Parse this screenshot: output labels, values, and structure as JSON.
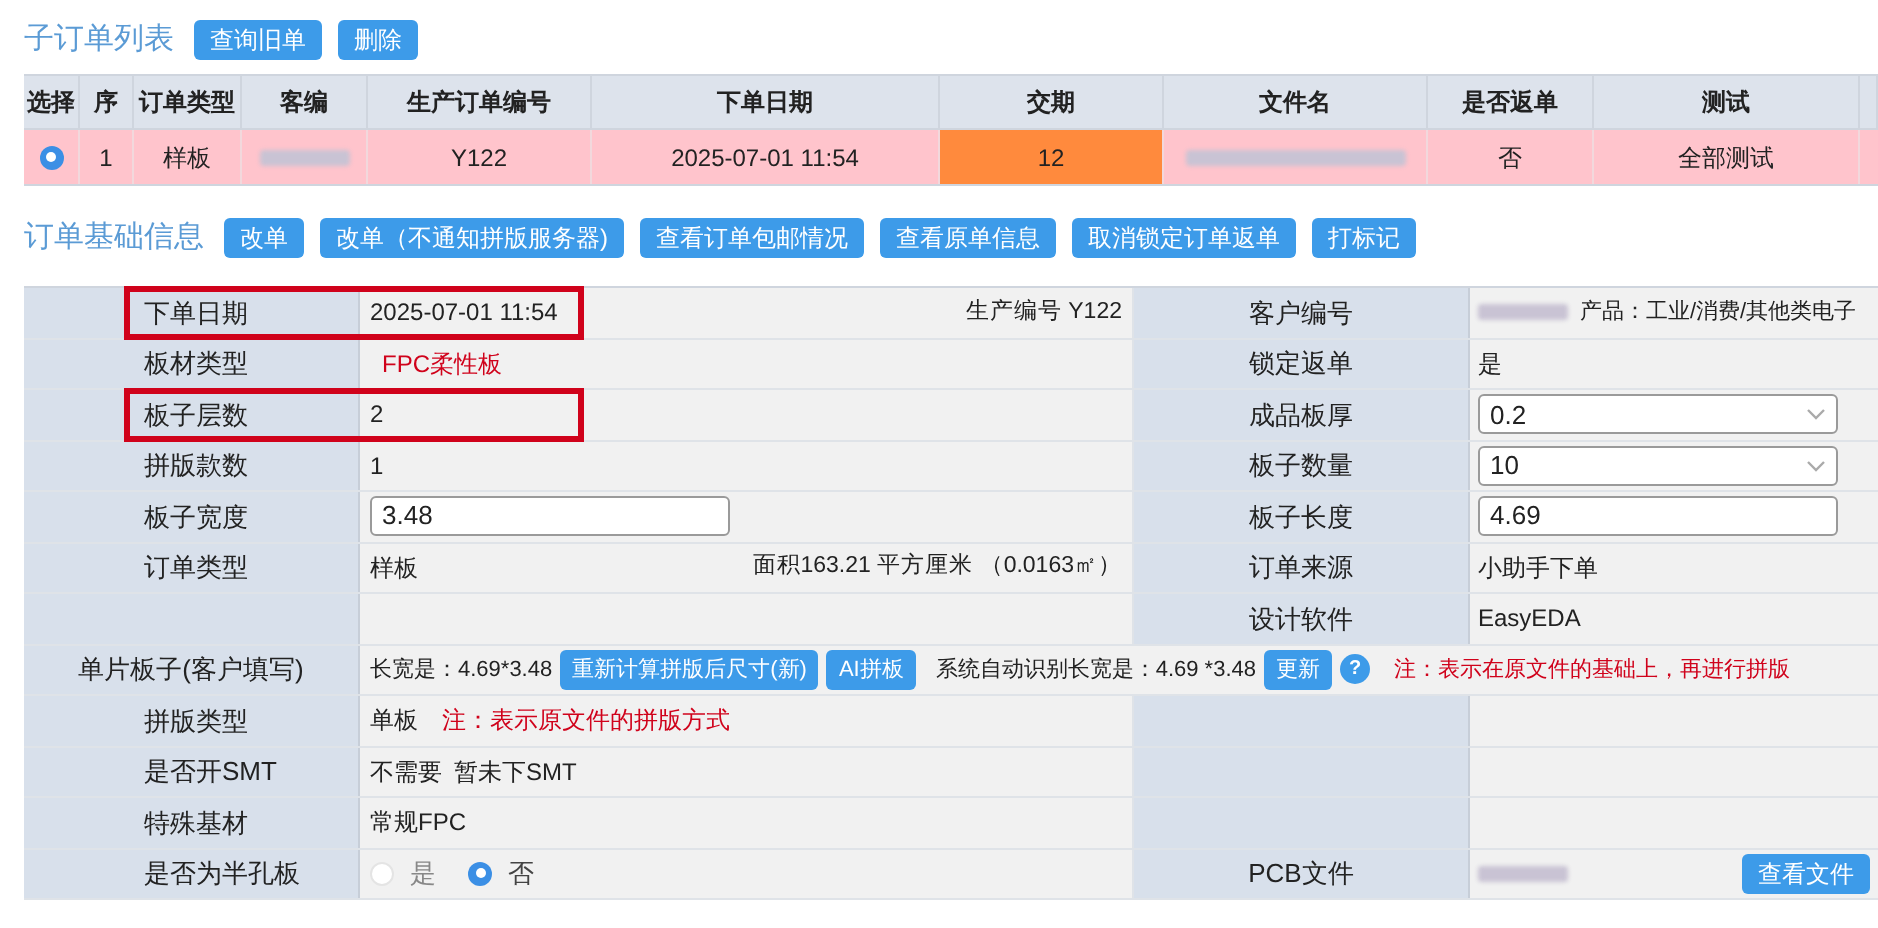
{
  "sub_orders": {
    "title": "子订单列表",
    "buttons": [
      "查询旧单",
      "删除"
    ],
    "columns": [
      "选择",
      "序",
      "订单类型",
      "客编",
      "生产订单编号",
      "下单日期",
      "交期",
      "文件名",
      "是否返单",
      "测试"
    ],
    "rows": [
      {
        "selected": true,
        "cells": [
          {
            "kind": "radio"
          },
          {
            "kind": "text",
            "text": "1"
          },
          {
            "kind": "text",
            "text": "样板"
          },
          {
            "kind": "blurred"
          },
          {
            "kind": "text",
            "text": "Y122"
          },
          {
            "kind": "text",
            "text": "2025-07-01 11:54"
          },
          {
            "kind": "text",
            "text": "12",
            "highlighted": true
          },
          {
            "kind": "blurred"
          },
          {
            "kind": "text",
            "text": "否"
          },
          {
            "kind": "text",
            "text": "全部测试"
          }
        ]
      }
    ]
  },
  "order_info": {
    "title": "订单基础信息",
    "buttons": [
      "改单",
      "改单（不通知拼版服务器)",
      "查看订单包邮情况",
      "查看原单信息",
      "取消锁定订单返单",
      "打标记"
    ],
    "rows": [
      {
        "kind": "pair",
        "highlighted": true,
        "label": "下单日期",
        "value": [
          {
            "kind": "text",
            "text": "2025-07-01 11:54"
          },
          {
            "kind": "aside",
            "text": "生产编号 Y122"
          }
        ],
        "label2": "客户编号",
        "value2": [
          {
            "kind": "blurred"
          },
          {
            "kind": "small",
            "text": "产品：工业/消费/其他类电子"
          }
        ]
      },
      {
        "kind": "pair",
        "highlighted": false,
        "label": "板材类型",
        "value": [
          {
            "kind": "red",
            "text": "FPC柔性板"
          }
        ],
        "label2": "锁定返单",
        "value2": [
          {
            "kind": "text",
            "text": "是"
          }
        ]
      },
      {
        "kind": "pair",
        "highlighted": true,
        "label": "板子层数",
        "value": [
          {
            "kind": "text",
            "text": "2"
          }
        ],
        "label2": "成品板厚",
        "value2": [
          {
            "kind": "select",
            "text": "0.2"
          }
        ]
      },
      {
        "kind": "pair",
        "highlighted": false,
        "label": "拼版款数",
        "value": [
          {
            "kind": "text",
            "text": "1"
          }
        ],
        "label2": "板子数量",
        "value2": [
          {
            "kind": "select",
            "text": "10"
          }
        ]
      },
      {
        "kind": "pair",
        "highlighted": false,
        "label": "板子宽度",
        "value": [
          {
            "kind": "input",
            "text": "3.48"
          }
        ],
        "label2": "板子长度",
        "value2": [
          {
            "kind": "input",
            "text": "4.69"
          }
        ]
      },
      {
        "kind": "pair",
        "highlighted": false,
        "label": "订单类型",
        "value": [
          {
            "kind": "text",
            "text": "样板"
          },
          {
            "kind": "aside",
            "text": "面积163.21 平方厘米 （0.0163㎡）"
          }
        ],
        "label2": "订单来源",
        "value2": [
          {
            "kind": "text",
            "text": "小助手下单"
          }
        ]
      },
      {
        "kind": "pair",
        "highlighted": false,
        "label2": "设计软件",
        "value2": [
          {
            "kind": "text",
            "text": "EasyEDA"
          }
        ]
      },
      {
        "kind": "wide",
        "label": "单片板子(客户填写)",
        "value": [
          {
            "kind": "text",
            "text": "长宽是：4.69*3.48"
          },
          {
            "kind": "button",
            "text": "重新计算拼版后尺寸(新)"
          },
          {
            "kind": "button",
            "text": "AI拼板"
          },
          {
            "kind": "spacer"
          },
          {
            "kind": "text",
            "text": "系统自动识别长宽是：4.69 *3.48"
          },
          {
            "kind": "button",
            "text": "更新"
          },
          {
            "kind": "help",
            "text": "?"
          },
          {
            "kind": "spacer"
          },
          {
            "kind": "red",
            "text": "注：表示在原文件的基础上，再进行拼版"
          }
        ]
      },
      {
        "kind": "pair",
        "highlighted": false,
        "label": "拼版类型",
        "value": [
          {
            "kind": "text",
            "text": "单板"
          },
          {
            "kind": "red",
            "text": "注：表示原文件的拼版方式"
          }
        ]
      },
      {
        "kind": "pair",
        "highlighted": false,
        "label": "是否开SMT",
        "value": [
          {
            "kind": "text",
            "text": "不需要"
          },
          {
            "kind": "text",
            "text": "暂未下SMT"
          }
        ]
      },
      {
        "kind": "pair",
        "highlighted": false,
        "label": "特殊基材",
        "value": [
          {
            "kind": "text",
            "text": "常规FPC"
          }
        ]
      },
      {
        "kind": "pair",
        "highlighted": false,
        "label": "是否为半孔板",
        "value": [
          {
            "kind": "radio",
            "text": "是",
            "selected": false
          },
          {
            "kind": "radio",
            "text": "否",
            "selected": true
          }
        ],
        "label2": "PCB文件",
        "value2": [
          {
            "kind": "blurred"
          },
          {
            "kind": "right_button",
            "text": "查看文件"
          }
        ]
      }
    ]
  }
}
